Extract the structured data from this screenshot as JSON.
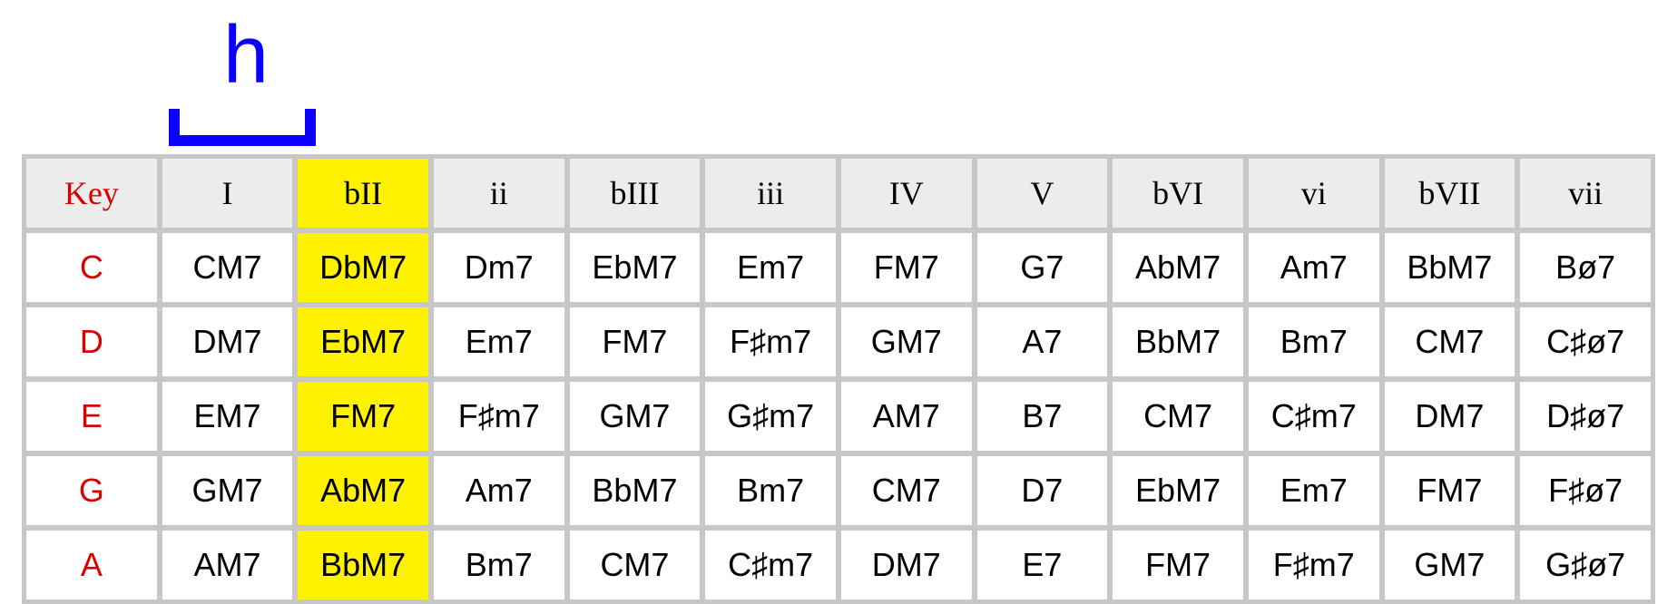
{
  "annotation": {
    "label": "h"
  },
  "table": {
    "headers": [
      "Key",
      "I",
      "bII",
      "ii",
      "bIII",
      "iii",
      "IV",
      "V",
      "bVI",
      "vi",
      "bVII",
      "vii"
    ],
    "highlight_col": 2,
    "rows": [
      {
        "key": "C",
        "cells": [
          "CM7",
          "DbM7",
          "Dm7",
          "EbM7",
          "Em7",
          "FM7",
          "G7",
          "AbM7",
          "Am7",
          "BbM7",
          "Bø7"
        ]
      },
      {
        "key": "D",
        "cells": [
          "DM7",
          "EbM7",
          "Em7",
          "FM7",
          "F♯m7",
          "GM7",
          "A7",
          "BbM7",
          "Bm7",
          "CM7",
          "C♯ø7"
        ]
      },
      {
        "key": "E",
        "cells": [
          "EM7",
          "FM7",
          "F♯m7",
          "GM7",
          "G♯m7",
          "AM7",
          "B7",
          "CM7",
          "C♯m7",
          "DM7",
          "D♯ø7"
        ]
      },
      {
        "key": "G",
        "cells": [
          "GM7",
          "AbM7",
          "Am7",
          "BbM7",
          "Bm7",
          "CM7",
          "D7",
          "EbM7",
          "Em7",
          "FM7",
          "F♯ø7"
        ]
      },
      {
        "key": "A",
        "cells": [
          "AM7",
          "BbM7",
          "Bm7",
          "CM7",
          "C♯m7",
          "DM7",
          "E7",
          "FM7",
          "F♯m7",
          "GM7",
          "G♯ø7"
        ]
      }
    ]
  }
}
